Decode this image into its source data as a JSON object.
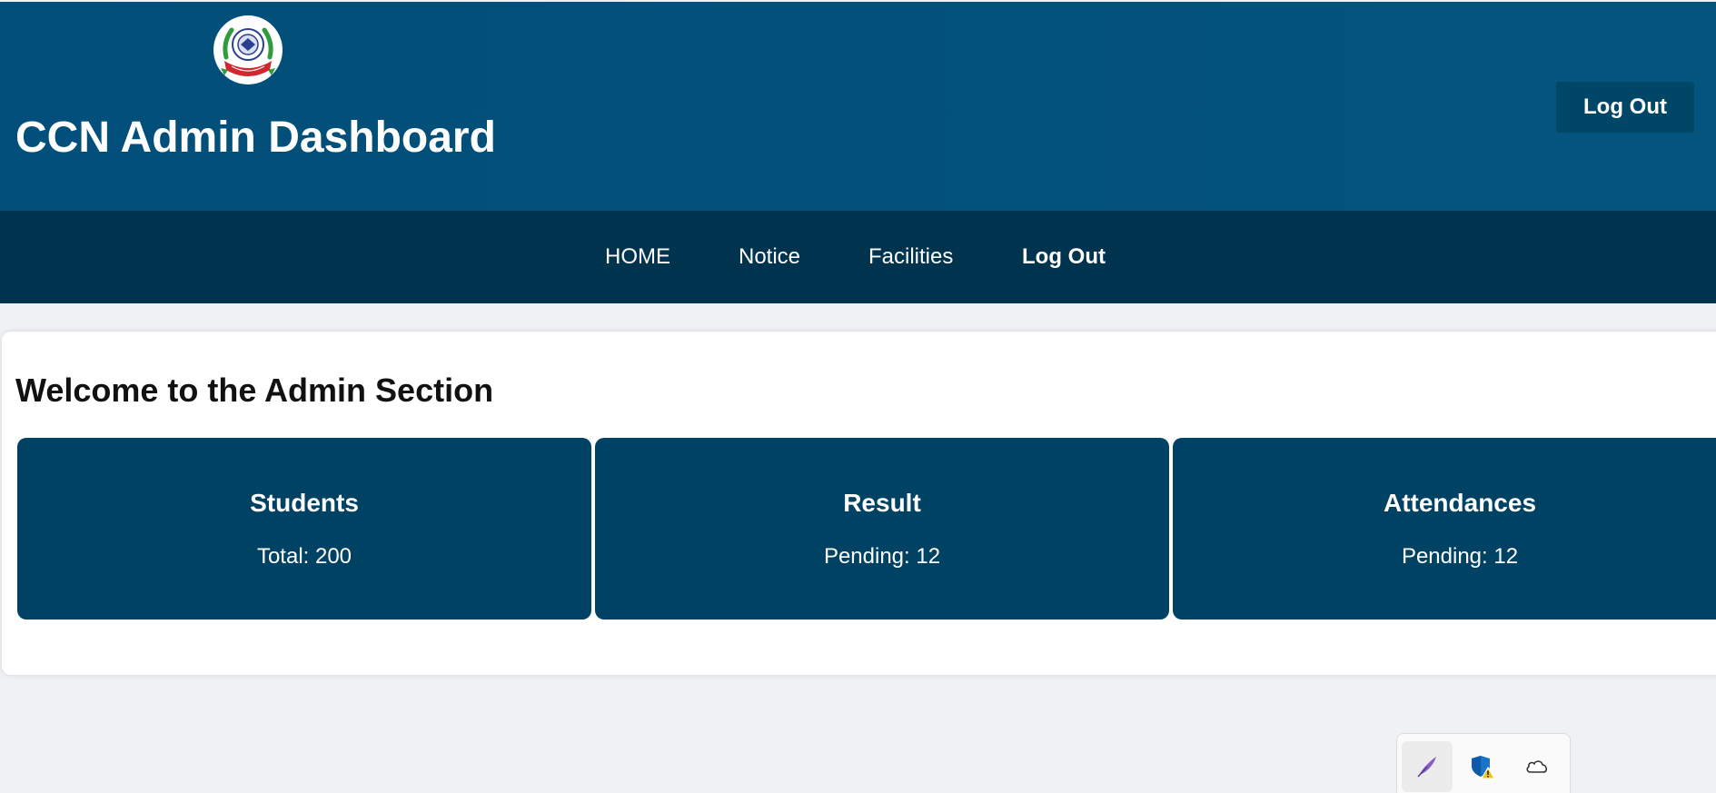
{
  "header": {
    "logo_icon": "college-seal-logo-icon",
    "title": "CCN Admin Dashboard",
    "logout_label": "Log Out"
  },
  "nav": {
    "items": [
      {
        "label": "HOME"
      },
      {
        "label": "Notice"
      },
      {
        "label": "Facilities"
      },
      {
        "label": "Log Out"
      }
    ]
  },
  "main": {
    "title": "Welcome to the Admin Section",
    "cards": [
      {
        "title": "Students",
        "stat": "Total: 200"
      },
      {
        "title": "Result",
        "stat": "Pending: 12"
      },
      {
        "title": "Attendances",
        "stat": "Pending: 12"
      }
    ]
  },
  "tray": {
    "icons": [
      "feather-pen-icon",
      "shield-warning-icon",
      "cloud-icon"
    ]
  },
  "colors": {
    "header_bg": "#014f7a",
    "nav_bg": "#00334e",
    "card_bg": "#004263",
    "page_bg": "#eff1f5",
    "logout_button_bg": "#004767"
  }
}
